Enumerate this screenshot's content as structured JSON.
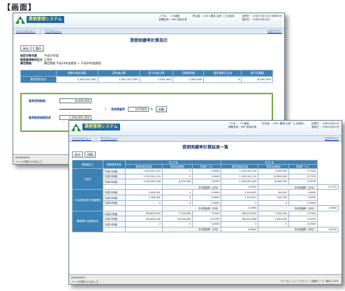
{
  "caption": "【画面】",
  "brand": "業務管理システム",
  "win1": {
    "info": [
      "ＪＡ名 ：ＪＡ福島",
      "部署名称：060 信用共済",
      "担当者 ：0001 農協 太郎（工台端末）",
      "処理日 ：25年03月31日 08時55分",
      "運用日 ：25年03月31日"
    ],
    "menu": {
      "main": "メインメニュー",
      "sub": "サブメニュー",
      "logout": "ログアウト"
    },
    "title": "貸倒実績率計算指示",
    "buttons": [
      "戻る",
      "実行"
    ],
    "meta": [
      {
        "k": "指定対象年度",
        "v": "平成24年度"
      },
      {
        "k": "期首基準期末区分",
        "v": "正常先"
      },
      {
        "k": "算定期間",
        "v": "算定期間  平成24年度期首 ～ 平成26年度期首"
      }
    ],
    "table_headers": [
      "",
      "基準年度末残高",
      "翌年度以降",
      "翌々年度以降",
      "当期償却額",
      "個別貸倒引当金",
      "差引計算額"
    ],
    "table_row": {
      "label": "期首残高合計",
      "values": [
        "1,200,001,000",
        "1,001,201,000",
        "7,000,000",
        "1,000,000",
        "0",
        "8,400,000"
      ]
    },
    "calc": {
      "label1": "基準貸倒期間",
      "value1": "8,000,000",
      "label2": "基準期首債権残高",
      "value2": "1,200,001,000",
      "eq": "＝",
      "rate_label": "貸倒実績率",
      "rate_value": "0.67000",
      "pct": "%",
      "calc_button": "計算"
    },
    "status": [
      "050004670",
      "ページが表示されました"
    ]
  },
  "win2": {
    "info": [
      "ＪＡ名 ：ＪＡ福島",
      "部署名称：060 信用共済",
      "担当者 ：0001 農協 太郎（工台端末）",
      "処理日 ：25年03月31日",
      "運用日 ：25年03月31日"
    ],
    "menu": {
      "main": "メインメニュー",
      "sub": "サブメニュー",
      "logout": "ログアウト"
    },
    "title": "貸倒実績率計算結果一覧",
    "buttons": [
      "戻る",
      "印刷"
    ],
    "group_headers": [
      "債務者区分",
      "期首基準年度",
      "前 正 後",
      "前 正 後"
    ],
    "col_headers": [
      "基準年度末残高",
      "基準年度償却",
      "貸倒率（%）",
      "基準年度末残高",
      "基準年度償却",
      "貸倒率（%）"
    ],
    "groups": [
      {
        "name": "正常先",
        "rows": [
          {
            "yr": "平成22年度",
            "v": [
              "1,310,001,210",
              "0",
              "0.0000",
              "1,310,001,210",
              "9,200,000",
              "0.7400"
            ]
          },
          {
            "yr": "平成23年度",
            "v": [
              "1,310,001,210",
              "0",
              "0.0000",
              "1,310,001,210",
              "10,000,000",
              "0.7070"
            ]
          },
          {
            "yr": "平成24年度",
            "v": [
              "1,200,001,000",
              "8,400,000",
              "0.6700",
              "1,200,001,000",
              "8,400,000",
              "0.6700"
            ]
          }
        ],
        "avg": [
          "平均貸倒率（平均）",
          "0.6700",
          "平均貸倒率（平均）",
          "0.7170"
        ]
      },
      {
        "name": "その他要注意先 要管理先",
        "rows": [
          {
            "yr": "平成22年度",
            "v": [
              "5,004,001",
              "0",
              "0.0000",
              "5,004,001",
              "80,000",
              "1.6000"
            ]
          },
          {
            "yr": "平成23年度",
            "v": [
              "7,104,001",
              "0",
              "0.0000",
              "7,104,001",
              "100,000",
              "1.3050"
            ]
          },
          {
            "yr": "平成24年度",
            "v": [
              "0",
              "0",
              "0.0000",
              "0",
              "0",
              "0.0000"
            ]
          }
        ],
        "avg": [
          "平均貸倒率（平均）",
          "0.0000",
          "平均貸倒率（平均）",
          "1.4600"
        ]
      },
      {
        "name": "要管理先 破綻懸念先",
        "rows": [
          {
            "yr": "平成22年度",
            "v": [
              "164,823,000",
              "5,300,000",
              "3.2000",
              "164,823,000",
              "5,300,000",
              "3.2000"
            ]
          },
          {
            "yr": "平成23年度",
            "v": [
              "164,823,000",
              "24,300,000",
              "14.0700",
              "164,823,000",
              "4,000,000",
              "2.4200"
            ]
          },
          {
            "yr": "平成24年度",
            "v": [
              "0",
              "0",
              "0.0000",
              "0",
              "0",
              "0.0000"
            ]
          }
        ],
        "avg": [
          "平均貸倒率（平均）",
          "8.6300",
          "平均貸倒率（平均）",
          "2.8100"
        ]
      }
    ],
    "status": [
      "050004671",
      "ページが表示されました"
    ],
    "status_right": "ローカル イントラネット | 保護モード: 無効    100%"
  }
}
